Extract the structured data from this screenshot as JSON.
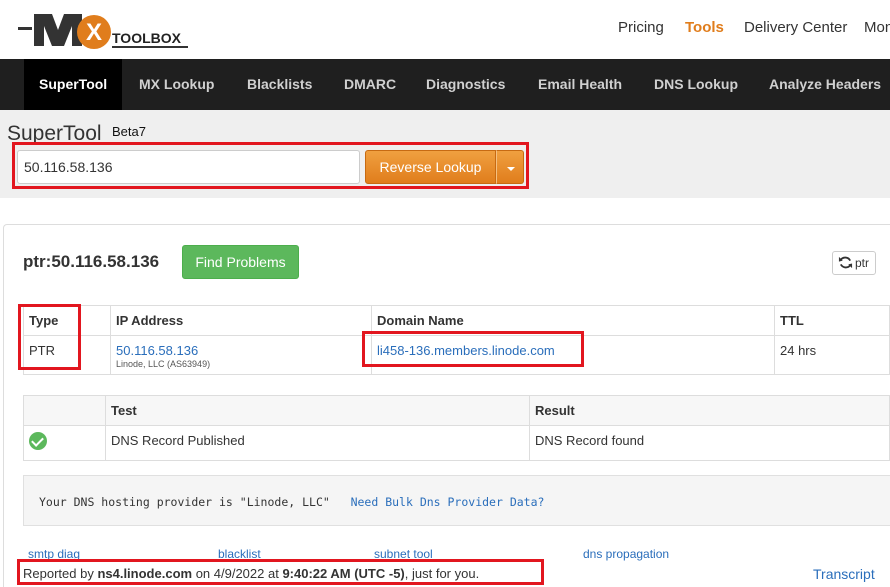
{
  "header": {
    "logo_text": "MX TOOLBOX",
    "nav": [
      {
        "label": "Pricing",
        "active": false
      },
      {
        "label": "Tools",
        "active": true
      },
      {
        "label": "Delivery Center",
        "active": false
      },
      {
        "label": "Mon",
        "active": false
      }
    ],
    "accent_color": "#e07d1c"
  },
  "tabs": [
    {
      "label": "SuperTool",
      "active": true
    },
    {
      "label": "MX Lookup",
      "active": false
    },
    {
      "label": "Blacklists",
      "active": false
    },
    {
      "label": "DMARC",
      "active": false
    },
    {
      "label": "Diagnostics",
      "active": false
    },
    {
      "label": "Email Health",
      "active": false
    },
    {
      "label": "DNS Lookup",
      "active": false
    },
    {
      "label": "Analyze Headers",
      "active": false
    }
  ],
  "supertool": {
    "title": "SuperTool",
    "beta": "Beta7",
    "input_value": "50.116.58.136",
    "button_label": "Reverse Lookup"
  },
  "result": {
    "title": "ptr:50.116.58.136",
    "find_problems_label": "Find Problems",
    "refresh_label": "ptr",
    "table": {
      "headers": [
        "Type",
        "IP Address",
        "Domain Name",
        "TTL"
      ],
      "row": {
        "type": "PTR",
        "ip": "50.116.58.136",
        "ip_owner": "Linode, LLC (AS63949)",
        "domain": "li458-136.members.linode.com",
        "ttl": "24 hrs"
      }
    },
    "tests": {
      "headers": [
        "",
        "Test",
        "Result"
      ],
      "rows": [
        {
          "status": "pass",
          "test": "DNS Record Published",
          "result": "DNS Record found"
        }
      ]
    },
    "info": {
      "text": "Your DNS hosting provider is \"Linode, LLC\"",
      "link": "Need Bulk Dns Provider Data?"
    },
    "quick_links": [
      "smtp diag",
      "blacklist",
      "subnet tool",
      "dns propagation"
    ],
    "reported": {
      "prefix": "Reported by ",
      "server": "ns4.linode.com",
      "mid": " on 4/9/2022 at ",
      "time": "9:40:22 AM (UTC -5)",
      "suffix": ", just for you."
    },
    "transcript_label": "Transcript"
  }
}
